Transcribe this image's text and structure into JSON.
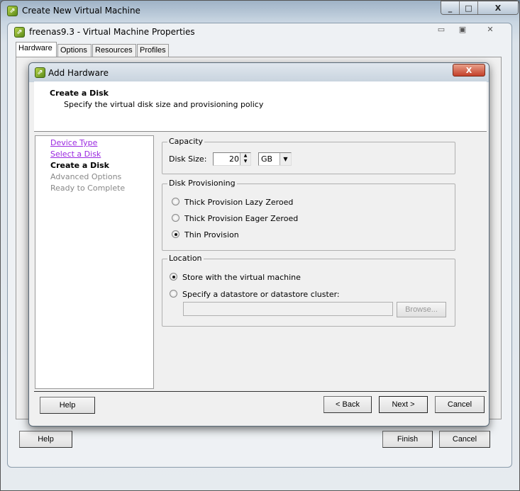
{
  "outer_window": {
    "title": "Create New Virtual Machine",
    "controls": {
      "minimize": "_",
      "maximize": "□",
      "close": "X"
    }
  },
  "properties_window": {
    "title": "freenas9.3 - Virtual Machine Properties",
    "tabs": [
      {
        "label": "Hardware",
        "active": true
      },
      {
        "label": "Options"
      },
      {
        "label": "Resources"
      },
      {
        "label": "Profiles"
      }
    ],
    "help_label": "Help",
    "finish_label": "Finish",
    "cancel_label": "Cancel"
  },
  "dialog": {
    "title": "Add Hardware",
    "close": "X",
    "header": {
      "title": "Create a Disk",
      "subtitle": "Specify the virtual disk size and provisioning policy"
    },
    "steps": [
      {
        "label": "Device Type",
        "state": "visited"
      },
      {
        "label": "Select a Disk",
        "state": "visited"
      },
      {
        "label": "Create a Disk",
        "state": "current"
      },
      {
        "label": "Advanced Options",
        "state": "pending"
      },
      {
        "label": "Ready to Complete",
        "state": "pending"
      }
    ],
    "capacity": {
      "legend": "Capacity",
      "disk_size_label": "Disk Size:",
      "disk_size_value": "20",
      "unit": "GB"
    },
    "provisioning": {
      "legend": "Disk Provisioning",
      "options": [
        {
          "label": "Thick Provision Lazy Zeroed",
          "selected": false
        },
        {
          "label": "Thick Provision Eager Zeroed",
          "selected": false
        },
        {
          "label": "Thin Provision",
          "selected": true
        }
      ]
    },
    "location": {
      "legend": "Location",
      "options": [
        {
          "label": "Store with the virtual machine",
          "selected": true
        },
        {
          "label": "Specify a datastore or datastore cluster:",
          "selected": false
        }
      ],
      "datastore_value": "",
      "browse_label": "Browse..."
    },
    "buttons": {
      "help": "Help",
      "back": "< Back",
      "next": "Next >",
      "cancel": "Cancel"
    }
  }
}
